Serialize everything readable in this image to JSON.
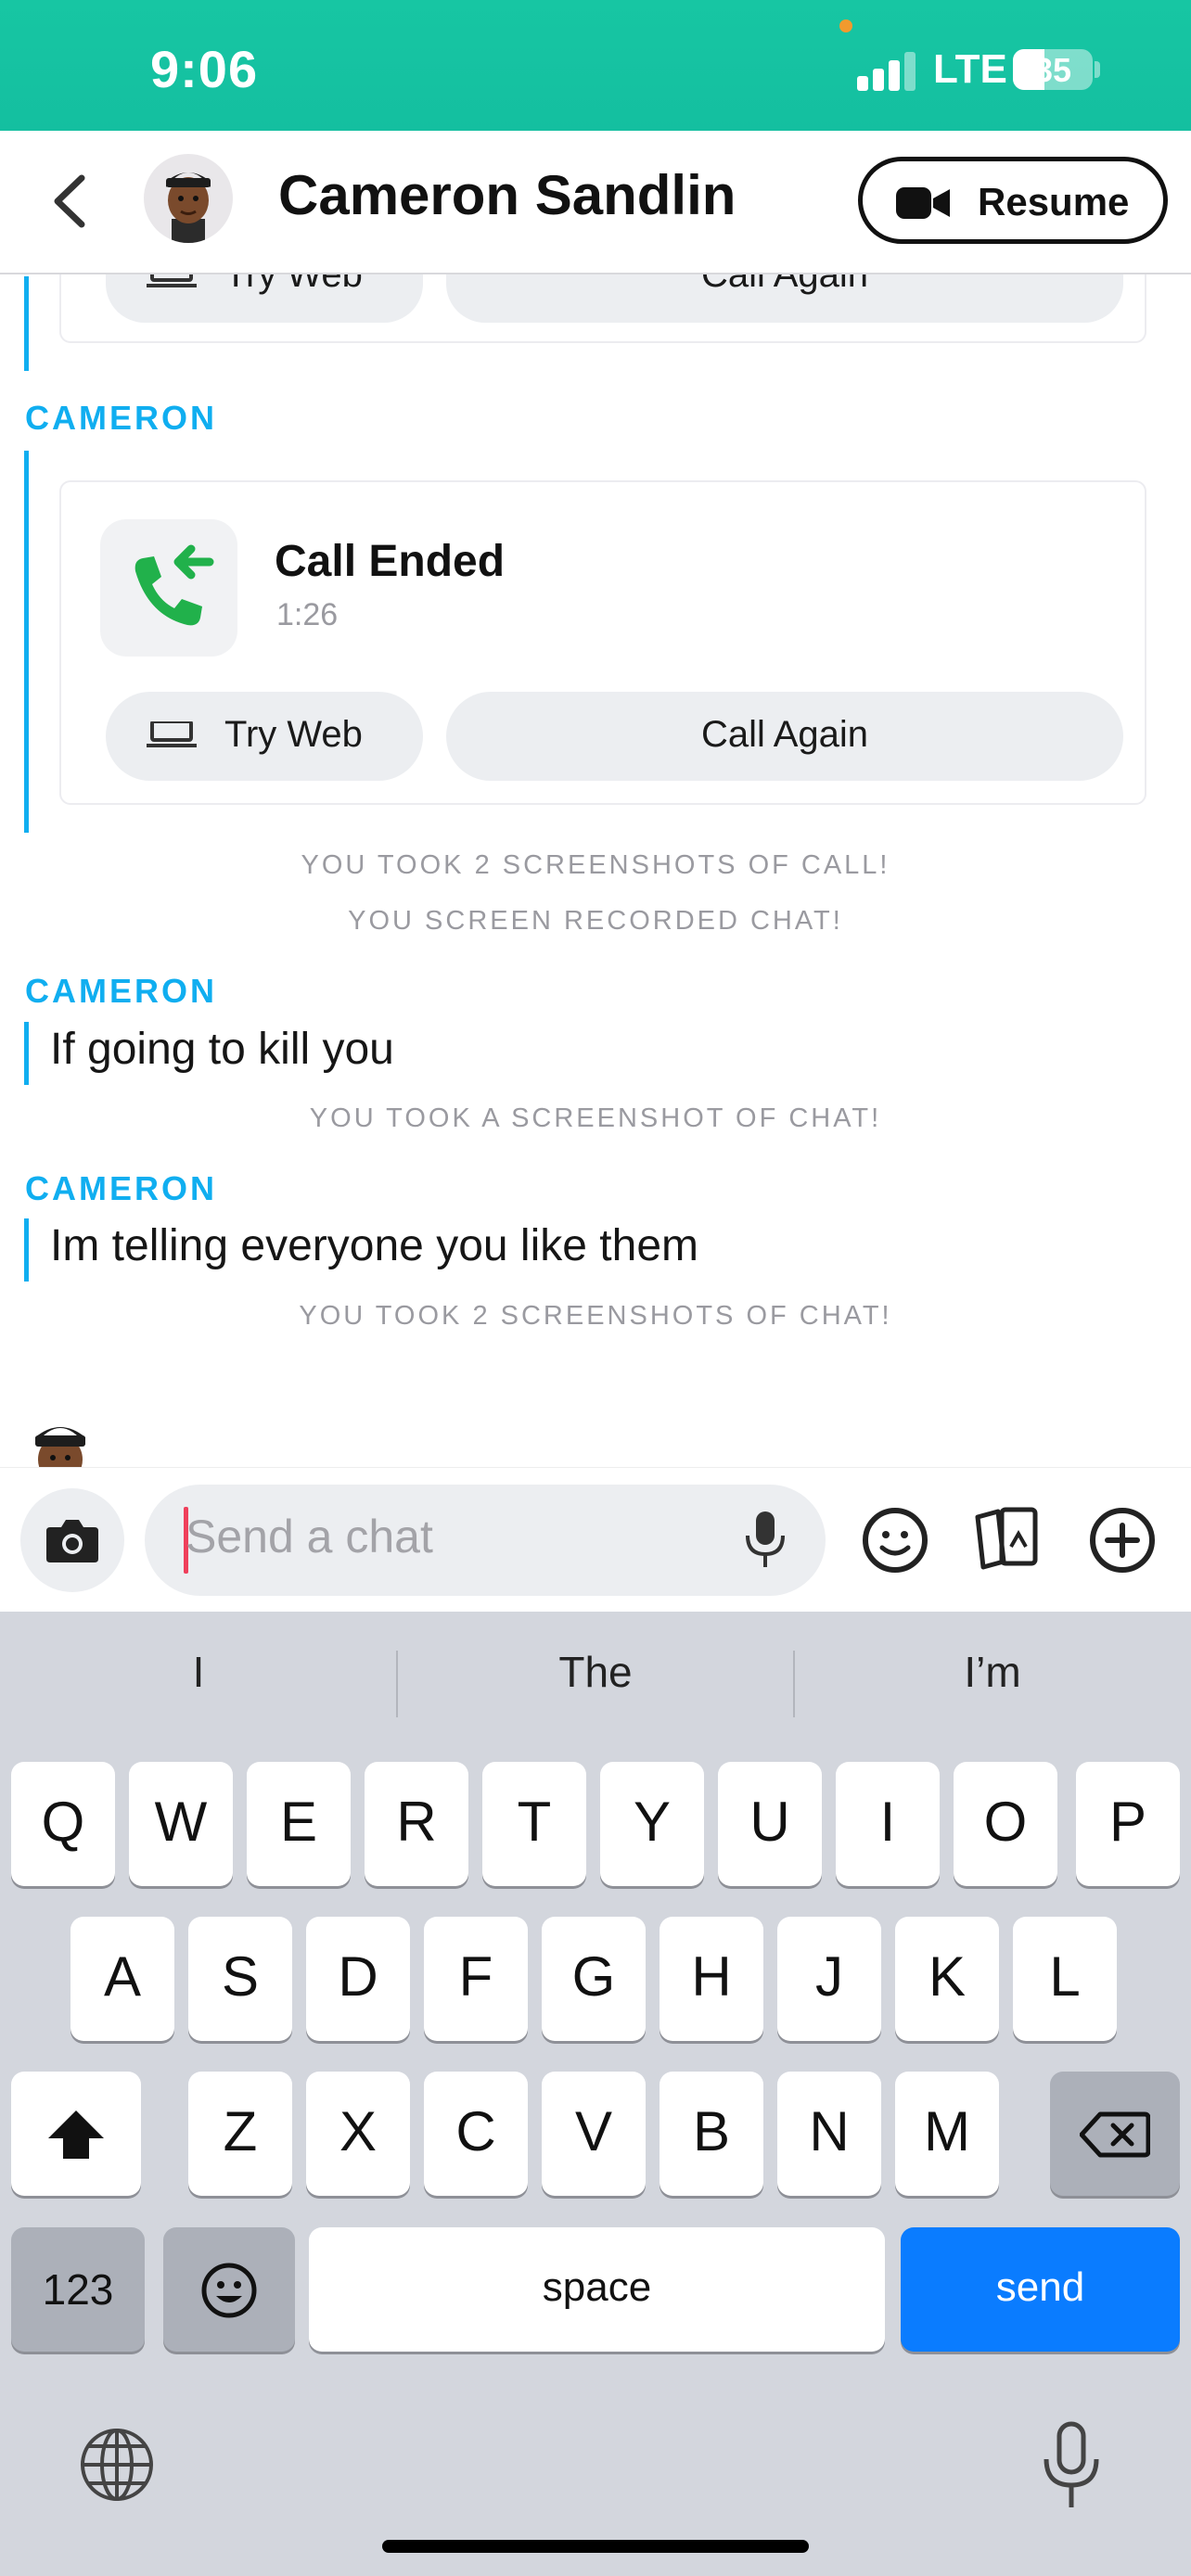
{
  "status_bar": {
    "time": "9:06",
    "network": "LTE",
    "battery": "35"
  },
  "header": {
    "contact_name": "Cameron Sandlin",
    "resume_label": "Resume"
  },
  "chat": {
    "top_card": {
      "try_web_label": "Try Web",
      "call_again_label": "Call Again"
    },
    "call_sender": "CAMERON",
    "call_card": {
      "title": "Call Ended",
      "duration": "1:26",
      "try_web_label": "Try Web",
      "call_again_label": "Call Again"
    },
    "system_1": "YOU TOOK 2 SCREENSHOTS OF CALL!",
    "system_2": "YOU SCREEN RECORDED CHAT!",
    "msg1_sender": "CAMERON",
    "msg1_text": "If going to kill you",
    "system_3": "YOU TOOK A SCREENSHOT OF CHAT!",
    "msg2_sender": "CAMERON",
    "msg2_text": "Im telling everyone you like them",
    "system_4": "YOU TOOK 2 SCREENSHOTS OF CHAT!"
  },
  "input": {
    "placeholder": "Send a chat"
  },
  "keyboard": {
    "suggestions": [
      "I",
      "The",
      "I’m"
    ],
    "row1": [
      "Q",
      "W",
      "E",
      "R",
      "T",
      "Y",
      "U",
      "I",
      "O",
      "P"
    ],
    "row2": [
      "A",
      "S",
      "D",
      "F",
      "G",
      "H",
      "J",
      "K",
      "L"
    ],
    "row3": [
      "Z",
      "X",
      "C",
      "V",
      "B",
      "N",
      "M"
    ],
    "numbers_label": "123",
    "space_label": "space",
    "send_label": "send"
  },
  "colors": {
    "status_bar": "#17c6a3",
    "accent_blue": "#10aef0",
    "send_key": "#0a7cff",
    "call_green": "#21b14b"
  }
}
